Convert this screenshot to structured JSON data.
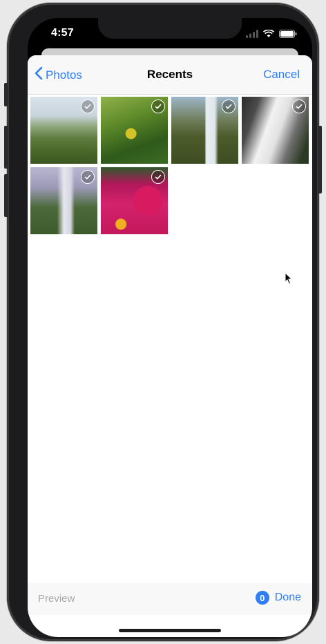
{
  "status_bar": {
    "time": "4:57"
  },
  "navbar": {
    "back_label": "Photos",
    "title": "Recents",
    "cancel_label": "Cancel"
  },
  "photos": [
    {
      "subject": "hillside-meadow",
      "selected": true
    },
    {
      "subject": "yellow-flower-leaves",
      "selected": true
    },
    {
      "subject": "waterfall-cliffs",
      "selected": true
    },
    {
      "subject": "waterfall-rocks",
      "selected": true
    },
    {
      "subject": "tall-waterfall",
      "selected": true
    },
    {
      "subject": "pink-flower-bed",
      "selected": true
    }
  ],
  "toolbar": {
    "preview_label": "Preview",
    "selected_count": "0",
    "done_label": "Done"
  },
  "colors": {
    "accent": "#2f7df6",
    "muted_text": "#a9a9a9",
    "bar_bg": "#f8f8f8"
  }
}
